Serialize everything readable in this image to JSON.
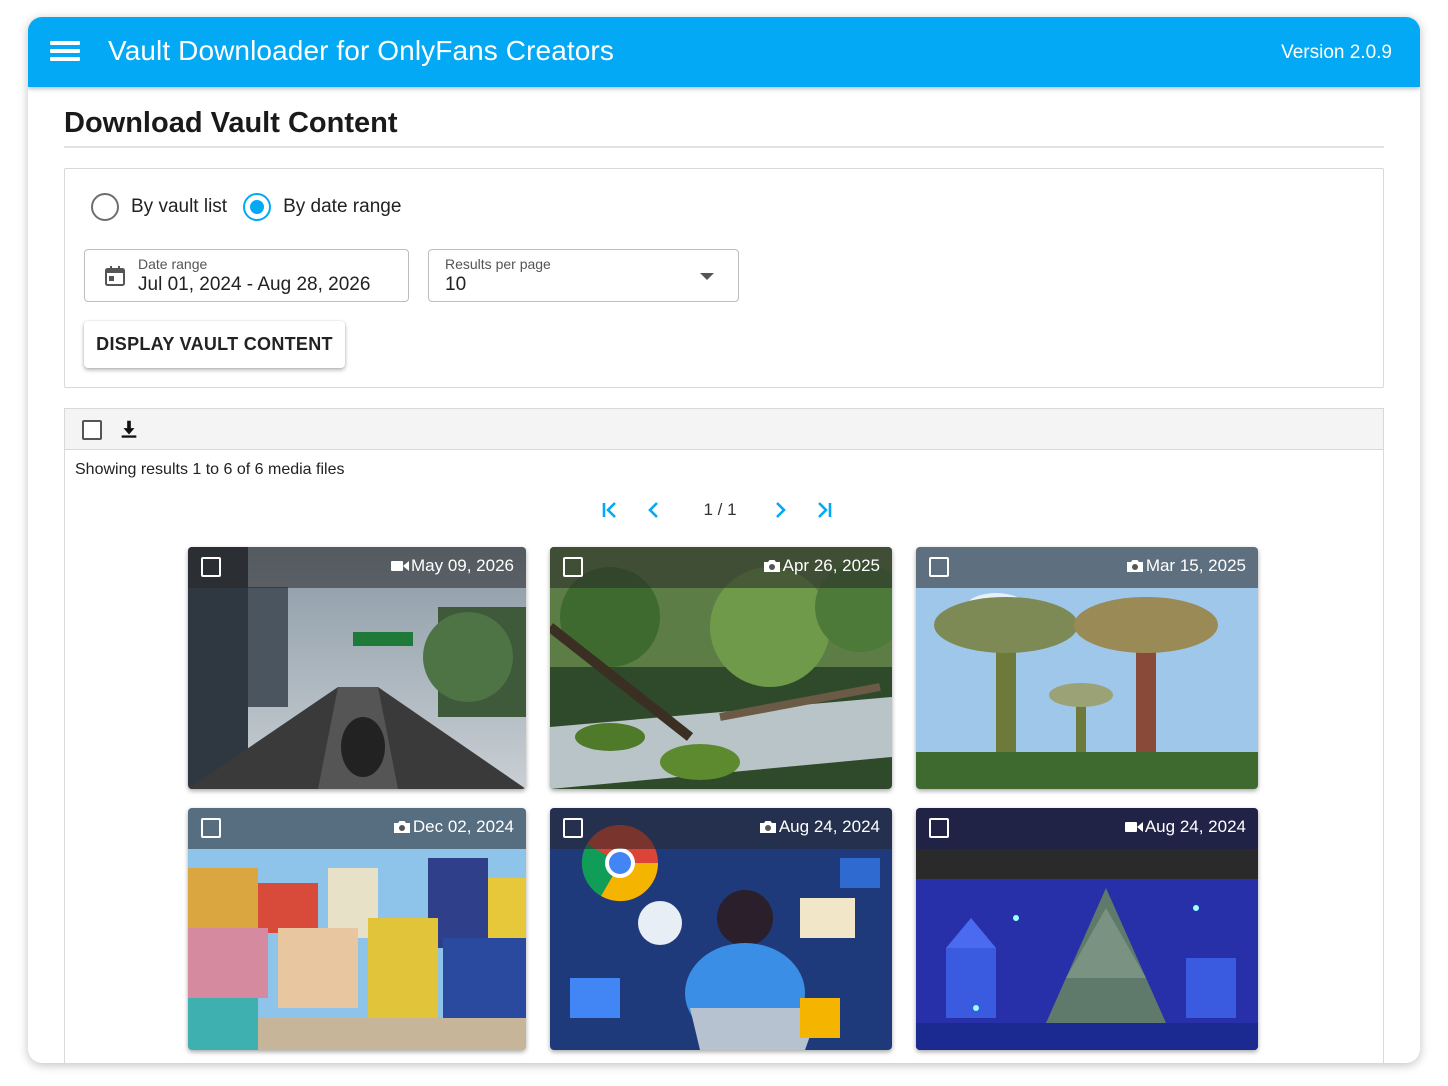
{
  "app": {
    "title": "Vault Downloader for OnlyFans Creators",
    "version": "Version 2.0.9",
    "accent_color": "#03a9f4"
  },
  "page": {
    "title": "Download Vault Content"
  },
  "filters": {
    "mode_options": [
      {
        "label": "By vault list",
        "selected": false
      },
      {
        "label": "By date range",
        "selected": true
      }
    ],
    "date_range": {
      "label": "Date range",
      "value": "Jul 01, 2024 - Aug 28, 2026",
      "icon": "calendar-icon"
    },
    "results_per_page": {
      "label": "Results per page",
      "value": "10"
    },
    "display_button": "DISPLAY VAULT CONTENT"
  },
  "results": {
    "summary": "Showing results 1 to 6 of 6 media files",
    "pagination": {
      "current": "1 / 1"
    },
    "media": [
      {
        "type": "video",
        "date": "May 09, 2026"
      },
      {
        "type": "photo",
        "date": "Apr 26, 2025"
      },
      {
        "type": "photo",
        "date": "Mar 15, 2025"
      },
      {
        "type": "photo",
        "date": "Dec 02, 2024"
      },
      {
        "type": "photo",
        "date": "Aug 24, 2024"
      },
      {
        "type": "video",
        "date": "Aug 24, 2024"
      }
    ]
  }
}
